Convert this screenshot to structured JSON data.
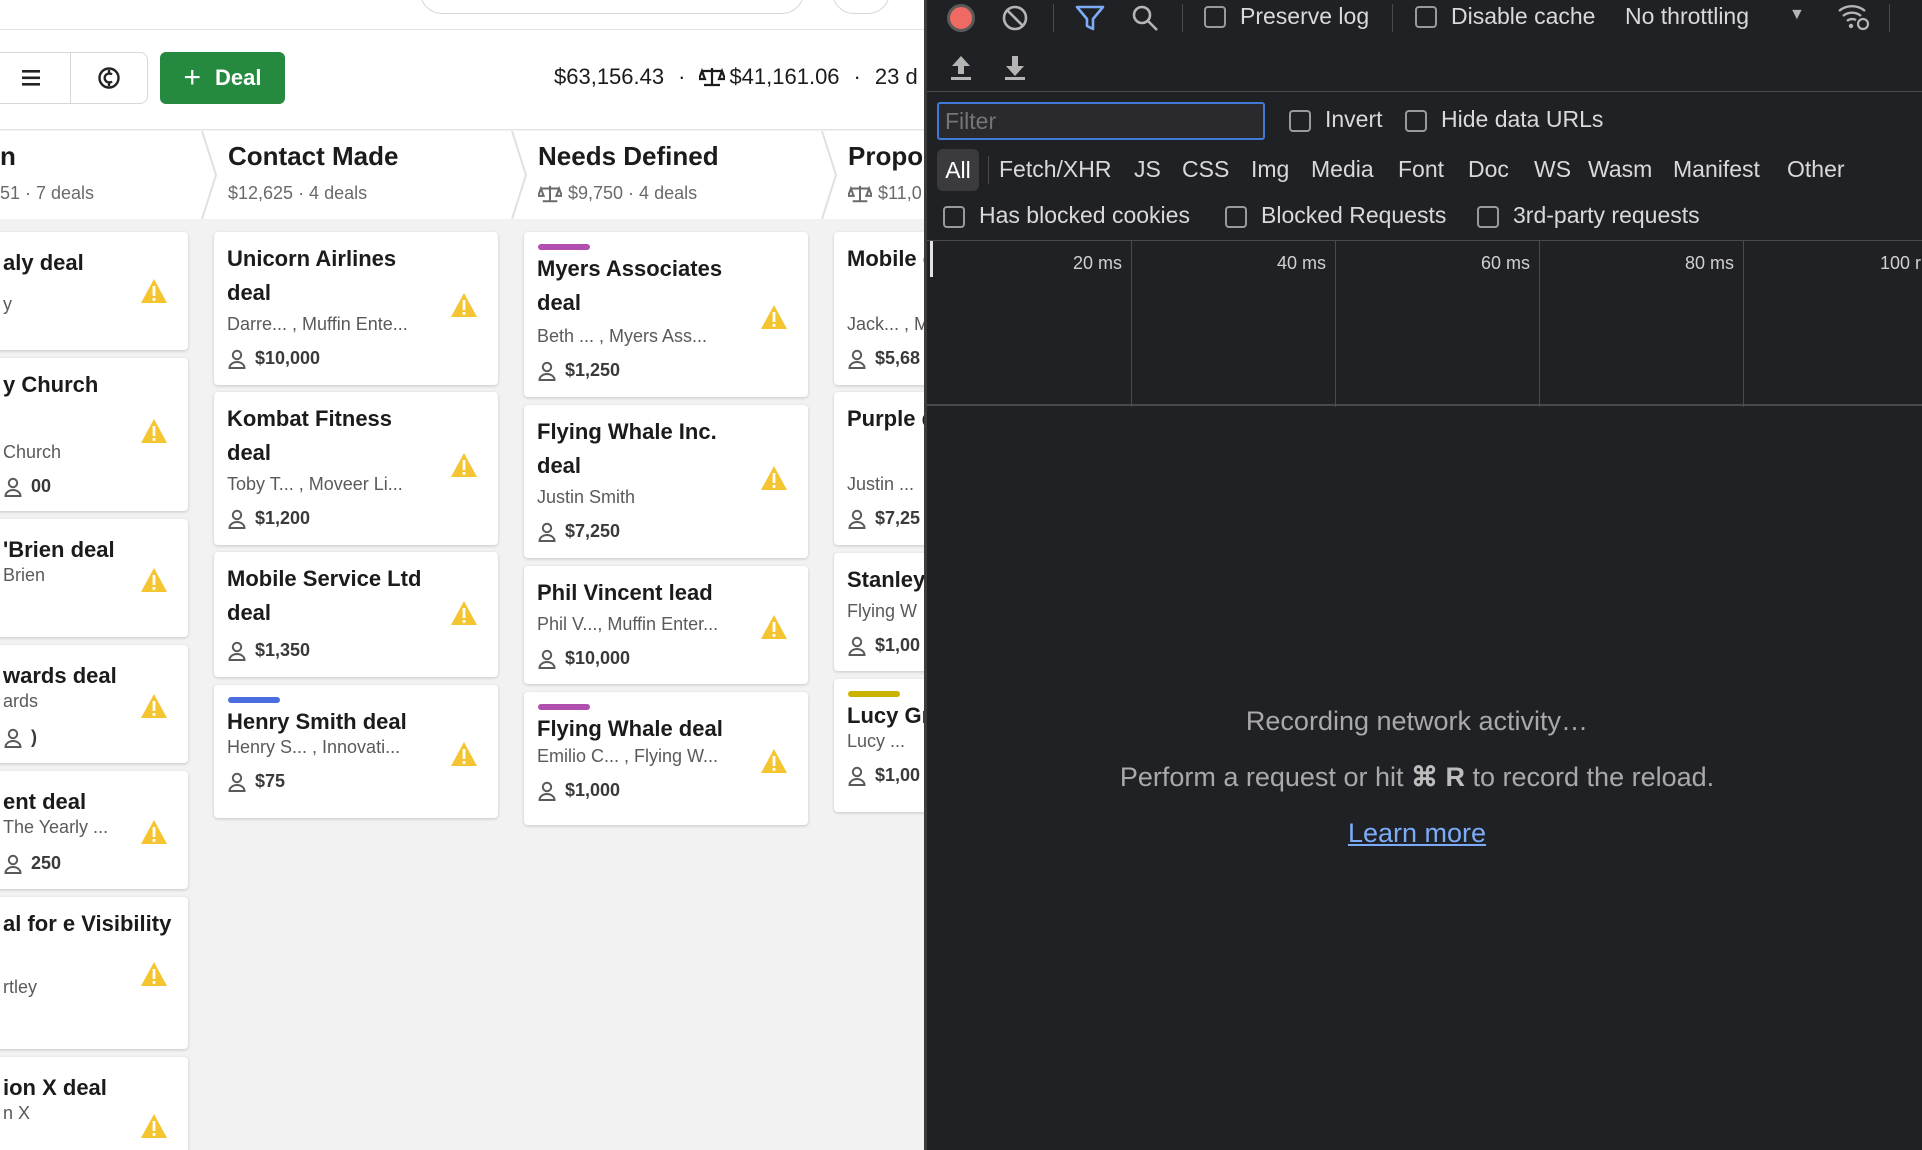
{
  "app": {
    "toolbar": {
      "deal_button_label": "Deal",
      "summary_total": "$63,156.43",
      "summary_weighted": "$41,161.06",
      "summary_count": "23 d",
      "separator": "·"
    },
    "stages": [
      {
        "title": "n",
        "subtitle": "51 · 7 deals",
        "weighted": false
      },
      {
        "title": "Contact Made",
        "subtitle": "$12,625 · 4 deals",
        "weighted": false
      },
      {
        "title": "Needs Defined",
        "subtitle": "$9,750 · 4 deals",
        "weighted": true
      },
      {
        "title": "Propo",
        "subtitle": "$11,0",
        "weighted": true
      }
    ],
    "columns": [
      {
        "cards": [
          {
            "title": "aly deal",
            "persons": "y",
            "value": ""
          },
          {
            "title": "y Church",
            "persons": "Church",
            "value": "00"
          },
          {
            "title": "'Brien deal",
            "persons": "Brien",
            "value": ""
          },
          {
            "title": "wards deal",
            "persons": "ards",
            "value": ")"
          },
          {
            "title": "ent deal",
            "persons": "The Yearly ...",
            "value": "250"
          },
          {
            "title": "al for e Visibility",
            "persons": "rtley",
            "value": ""
          },
          {
            "title": "ion X deal",
            "persons": "n X",
            "value": ""
          }
        ]
      },
      {
        "cards": [
          {
            "title": "Unicorn Airlines deal",
            "persons": "Darre... , Muffin Ente...",
            "value": "$10,000",
            "bar": ""
          },
          {
            "title": "Kombat Fitness deal",
            "persons": "Toby T... , Moveer Li...",
            "value": "$1,200",
            "bar": ""
          },
          {
            "title": "Mobile Service Ltd deal",
            "persons": "",
            "value": "$1,350",
            "bar": ""
          },
          {
            "title": "Henry Smith deal",
            "persons": "Henry S... , Innovati...",
            "value": "$75",
            "bar": "#4a6ee0"
          }
        ]
      },
      {
        "cards": [
          {
            "title": "Myers Associates deal",
            "persons": "Beth ... , Myers Ass...",
            "value": "$1,250",
            "bar": "#b14fb0"
          },
          {
            "title": "Flying Whale Inc. deal",
            "persons": "Justin Smith",
            "value": "$7,250",
            "bar": ""
          },
          {
            "title": "Phil Vincent lead",
            "persons": "Phil V..., Muffin Enter...",
            "value": "$10,000",
            "bar": ""
          },
          {
            "title": "Flying Whale deal",
            "persons": "Emilio C... , Flying W...",
            "value": "$1,000",
            "bar": "#b14fb0"
          }
        ]
      },
      {
        "cards": [
          {
            "title": "Mobile compar",
            "persons": "Jack... , M",
            "value": "$5,68",
            "bar": ""
          },
          {
            "title": "Purple deal",
            "persons": "Justin ...",
            "value": "$7,25",
            "bar": ""
          },
          {
            "title": "Stanley",
            "persons": "Flying W",
            "value": "$1,00",
            "bar": ""
          },
          {
            "title": "Lucy Gr",
            "persons": "Lucy ...",
            "value": "$1,00",
            "bar": "#c9b200"
          }
        ]
      }
    ]
  },
  "devtools": {
    "preserve_log": "Preserve log",
    "disable_cache": "Disable cache",
    "throttling": "No throttling",
    "filter_placeholder": "Filter",
    "invert": "Invert",
    "hide_data_urls": "Hide data URLs",
    "types": [
      "All",
      "Fetch/XHR",
      "JS",
      "CSS",
      "Img",
      "Media",
      "Font",
      "Doc",
      "WS",
      "Wasm",
      "Manifest",
      "Other"
    ],
    "has_blocked_cookies": "Has blocked cookies",
    "blocked_requests": "Blocked Requests",
    "third_party": "3rd-party requests",
    "timeline_labels": [
      "20 ms",
      "40 ms",
      "60 ms",
      "80 ms",
      "100 r"
    ],
    "empty_line1": "Recording network activity…",
    "empty_line2_pre": "Perform a request or hit",
    "empty_line2_key": "⌘ R",
    "empty_line2_post": "to record the reload.",
    "learn_more": "Learn more",
    "colors": {
      "record": "#ef6a63",
      "filter_active": "#7cacf8",
      "link": "#7cacf8"
    }
  },
  "colors": {
    "deal_button": "#258a3f",
    "warning": "#f4c531"
  }
}
